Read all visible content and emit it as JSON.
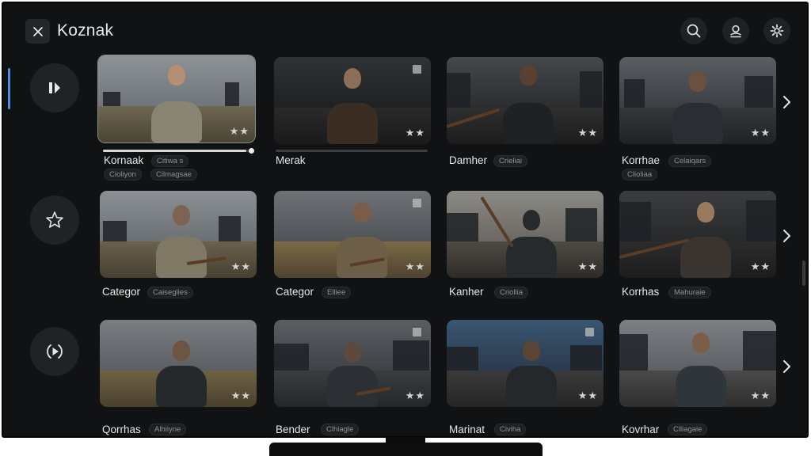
{
  "app": {
    "title": "Koznak"
  },
  "rows": [
    {
      "cards": [
        {
          "title": "Kornaak",
          "tags": [
            "Citiwa s",
            "Cioliyon",
            "Cilmagsae"
          ]
        },
        {
          "title": "Merak",
          "tags": []
        },
        {
          "title": "Damher",
          "tags": [
            "Crieliai"
          ]
        },
        {
          "title": "Korrhae",
          "tags": [
            "Celaiqars",
            "Clioliaa"
          ]
        }
      ]
    },
    {
      "cards": [
        {
          "title": "Categor",
          "tags": [
            "Caiseglies"
          ]
        },
        {
          "title": "Categor",
          "tags": [
            "Elliee"
          ]
        },
        {
          "title": "Kanher",
          "tags": [
            "Criollia"
          ]
        },
        {
          "title": "Korrhas",
          "tags": [
            "Mahuraie"
          ]
        }
      ]
    },
    {
      "cards": [
        {
          "title": "Qorrhas",
          "tags": [
            "Alhiiyne"
          ]
        },
        {
          "title": "Bender",
          "tags": [
            "Clhiagle"
          ]
        },
        {
          "title": "Marinat",
          "tags": [
            "Civiha"
          ]
        },
        {
          "title": "Kovrhar",
          "tags": [
            "Clliagaie"
          ]
        }
      ]
    }
  ],
  "focused_card": {
    "row": 0,
    "col": 0,
    "progress_fraction": 0.95
  },
  "icons": {
    "close": "close-icon",
    "search": "search-icon",
    "profile": "profile-icon",
    "settings": "settings-icon",
    "play_pause": "play-pause-icon",
    "favorite": "star-icon",
    "next": "play-circle-icon",
    "chevron": "chevron-right-icon"
  },
  "colors": {
    "accent": "#4a90e2",
    "background": "#111213"
  }
}
